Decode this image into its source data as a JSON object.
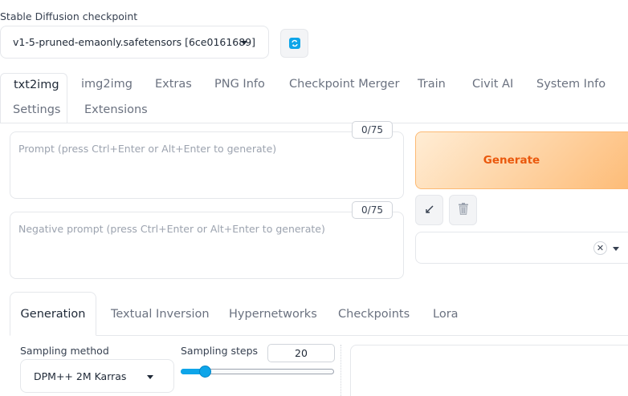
{
  "checkpoint": {
    "label": "Stable Diffusion checkpoint",
    "selected": "v1-5-pruned-emaonly.safetensors [6ce0161689]",
    "refresh_icon": "refresh-icon"
  },
  "main_tabs": [
    {
      "label": "txt2img",
      "active": true
    },
    {
      "label": "img2img"
    },
    {
      "label": "Extras"
    },
    {
      "label": "PNG Info"
    },
    {
      "label": "Checkpoint Merger"
    },
    {
      "label": "Train"
    },
    {
      "label": "Civit AI"
    },
    {
      "label": "System Info"
    },
    {
      "label": "Settings"
    },
    {
      "label": "Extensions"
    }
  ],
  "prompt": {
    "placeholder": "Prompt (press Ctrl+Enter or Alt+Enter to generate)",
    "value": "",
    "token_count": "0/75"
  },
  "negative_prompt": {
    "placeholder": "Negative prompt (press Ctrl+Enter or Alt+Enter to generate)",
    "value": "",
    "token_count": "0/75"
  },
  "generate": {
    "label": "Generate",
    "read_prompt_icon": "arrow-icon",
    "trash_icon": "trash-icon",
    "style_clear_glyph": "✕"
  },
  "generation_tabs": [
    {
      "label": "Generation",
      "active": true
    },
    {
      "label": "Textual Inversion"
    },
    {
      "label": "Hypernetworks"
    },
    {
      "label": "Checkpoints"
    },
    {
      "label": "Lora"
    }
  ],
  "sampling": {
    "method_label": "Sampling method",
    "method_value": "DPM++ 2M Karras",
    "steps_label": "Sampling steps",
    "steps_value": "20",
    "steps_min": 1,
    "steps_max": 150,
    "steps_level": 20
  },
  "colors": {
    "accent": "#0ea5e9",
    "generate_text": "#ea580c",
    "generate_bg": "#fdba74"
  }
}
